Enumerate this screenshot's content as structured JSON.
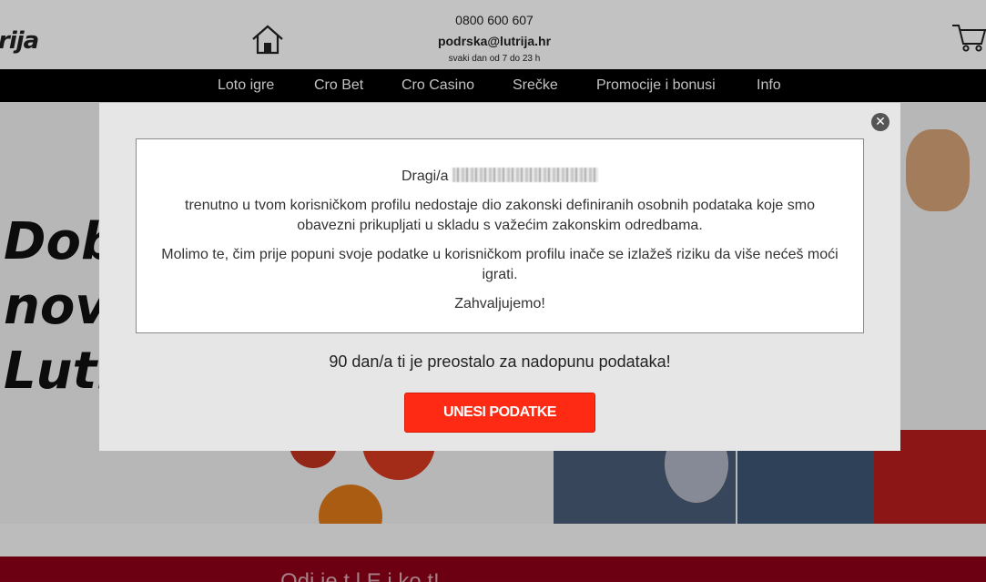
{
  "header": {
    "logo_text": "rija",
    "phone": "0800 600 607",
    "email": "podrska@lutrija.hr",
    "hours": "svaki dan od 7 do 23 h",
    "home_icon": "home-icon",
    "cart_icon": "cart-icon"
  },
  "nav": {
    "items": [
      {
        "label": "Loto igre"
      },
      {
        "label": "Cro Bet"
      },
      {
        "label": "Cro Casino"
      },
      {
        "label": "Srečke"
      },
      {
        "label": "Promocije i bonusi"
      },
      {
        "label": "Info"
      }
    ]
  },
  "hero": {
    "line1": "Dob",
    "line2": "nov",
    "line3": "Luti"
  },
  "promo_band": {
    "text": "Odi    je t    l                E    i    ko  t!"
  },
  "modal": {
    "close_icon": "close-icon",
    "greeting": "Dragi/a",
    "paragraph1": "trenutno u tvom korisničkom profilu nedostaje dio zakonski definiranih osobnih podataka koje smo obavezni prikupljati u skladu s važećim zakonskim odredbama.",
    "paragraph2": "Molimo te, čim prije popuni svoje podatke u korisničkom profilu inače se izlažeš riziku da više nećeš moći igrati.",
    "thanks": "Zahvaljujemo!",
    "remaining": "90 dan/a ti je preostalo za nadopunu podataka!",
    "cta_label": "UNESI PODATKE"
  },
  "colors": {
    "nav_bg": "#000000",
    "cta_bg": "#ff2a14",
    "promo_bg": "#8f0018",
    "modal_bg": "#e6e6e6"
  }
}
